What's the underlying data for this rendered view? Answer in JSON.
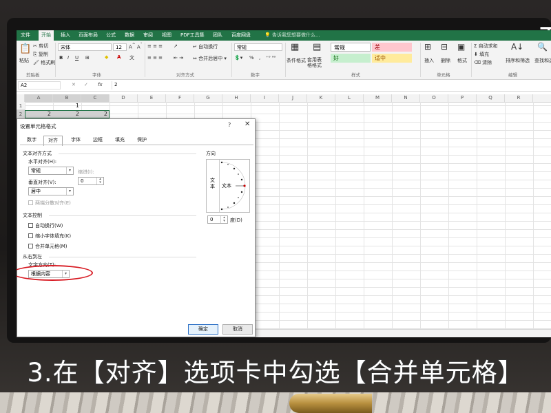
{
  "ribbon": {
    "tabs": [
      "文件",
      "开始",
      "插入",
      "页面布局",
      "公式",
      "数据",
      "审阅",
      "视图",
      "PDF工具集",
      "团队",
      "百度网盘"
    ],
    "tell_me": "告诉我您想要做什么...",
    "clipboard": {
      "paste": "粘贴",
      "cut": "剪切",
      "copy": "复制",
      "format_painter": "格式刷",
      "group": "剪贴板"
    },
    "font": {
      "name": "宋体",
      "size": "12",
      "group": "字体"
    },
    "alignment": {
      "wrap": "自动换行",
      "merge": "合并后居中",
      "group": "对齐方式"
    },
    "number": {
      "format": "常规",
      "percent": "%",
      "group": "数字"
    },
    "styles": {
      "cond": "条件格式",
      "table": "套用表格格式",
      "normal": "常规",
      "bad": "差",
      "good": "好",
      "neutral": "适中",
      "group": "样式",
      "colors": {
        "bad": "#ffc7ce",
        "good": "#c6efce",
        "neutral": "#ffeb9c"
      }
    },
    "cells": {
      "insert": "插入",
      "delete": "删除",
      "format": "格式",
      "group": "单元格"
    },
    "editing": {
      "autosum": "自动求和",
      "fill": "填充",
      "clear": "清除",
      "sort": "排序和筛选",
      "find": "查找和选择",
      "group": "编辑"
    }
  },
  "formula_bar": {
    "name_box": "A2",
    "fx": "fx",
    "value": "2"
  },
  "grid": {
    "columns": [
      "A",
      "B",
      "C",
      "D",
      "E",
      "F",
      "G",
      "H",
      "I",
      "J",
      "K",
      "L",
      "M",
      "N",
      "O",
      "P",
      "Q",
      "R"
    ],
    "rows": [
      "1",
      "2"
    ],
    "row1": [
      "",
      "1",
      ""
    ],
    "row2": [
      "2",
      "2",
      "2"
    ]
  },
  "dialog": {
    "title": "设置单元格格式",
    "help": "?",
    "close": "✕",
    "tabs": [
      "数字",
      "对齐",
      "字体",
      "边框",
      "填充",
      "保护"
    ],
    "text_alignment": "文本对齐方式",
    "horizontal_label": "水平对齐(H):",
    "horizontal_value": "常规",
    "indent_label": "缩进(I):",
    "indent_value": "0",
    "vertical_label": "垂直对齐(V):",
    "vertical_value": "居中",
    "justify_distributed": "两端分散对齐(E)",
    "text_control": "文本控制",
    "wrap_text": "自动换行(W)",
    "shrink_to_fit": "缩小字体填充(K)",
    "merge_cells": "合并单元格(M)",
    "rtl": "从右到左",
    "direction_label": "文字方向(T):",
    "direction_value": "根据内容",
    "orientation": "方向",
    "orient_text": "文本",
    "orient_text2": "文本",
    "degree_value": "0",
    "degree_label": "度(D)",
    "ok": "确定",
    "cancel": "取消"
  },
  "caption": "3.在【对齐】选项卡中勾选【合并单元格】",
  "brand_partial": "天"
}
